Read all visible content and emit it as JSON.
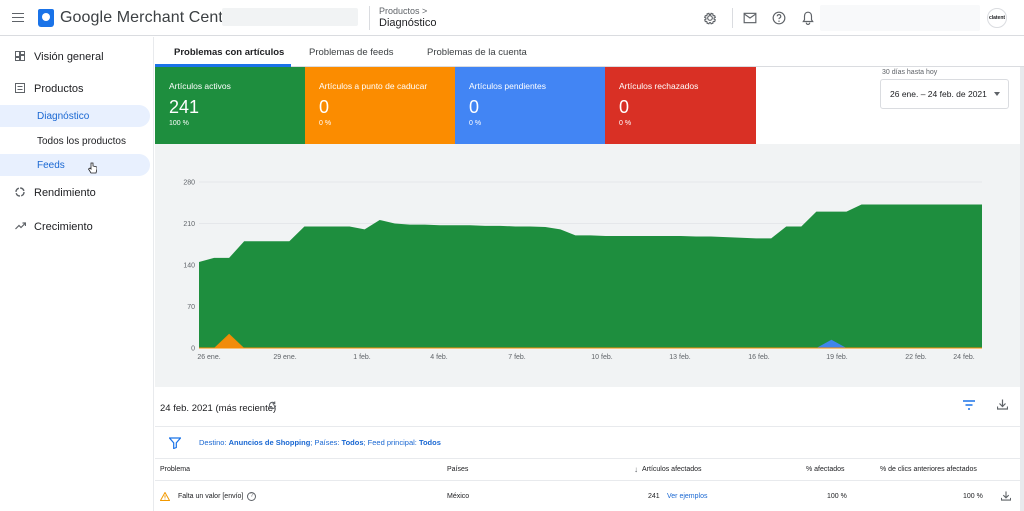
{
  "app": {
    "logo_text": "Google Merchant Center",
    "breadcrumb_parent": "Productos >",
    "breadcrumb_current": "Diagnóstico",
    "avatar_text": "clatent",
    "icons": [
      "menu-icon",
      "settings-icon",
      "mail-icon",
      "help-icon",
      "notifications-icon"
    ]
  },
  "sidebar": {
    "items": [
      {
        "label": "Visión general",
        "icon": "dashboard-icon"
      },
      {
        "label": "Productos",
        "icon": "list-icon"
      },
      {
        "label": "Diagnóstico"
      },
      {
        "label": "Todos los productos"
      },
      {
        "label": "Feeds"
      },
      {
        "label": "Rendimiento",
        "icon": "performance-icon"
      },
      {
        "label": "Crecimiento",
        "icon": "growth-icon"
      }
    ]
  },
  "tabs": [
    {
      "label": "Problemas con artículos",
      "active": true
    },
    {
      "label": "Problemas de feeds",
      "active": false
    },
    {
      "label": "Problemas de la cuenta",
      "active": false
    }
  ],
  "cards": [
    {
      "label": "Artículos activos",
      "value": "241",
      "pct": "100 %",
      "color": "#1e8e3e"
    },
    {
      "label": "Artículos a punto de caducar",
      "value": "0",
      "pct": "0 %",
      "color": "#fb8c00"
    },
    {
      "label": "Artículos pendientes",
      "value": "0",
      "pct": "0 %",
      "color": "#4285f4"
    },
    {
      "label": "Artículos rechazados",
      "value": "0",
      "pct": "0 %",
      "color": "#d93025"
    }
  ],
  "date_range": {
    "label": "30 días hasta hoy",
    "value": "26 ene. – 24 feb. de 2021"
  },
  "chart_data": {
    "type": "area",
    "x": [
      "26 ene.",
      "27 ene.",
      "28 ene.",
      "29 ene.",
      "30 ene.",
      "31 ene.",
      "1 feb.",
      "2 feb.",
      "3 feb.",
      "4 feb.",
      "5 feb.",
      "6 feb.",
      "7 feb.",
      "8 feb.",
      "9 feb.",
      "10 feb.",
      "11 feb.",
      "12 feb.",
      "13 feb.",
      "14 feb.",
      "15 feb.",
      "16 feb.",
      "17 feb.",
      "18 feb.",
      "19 feb.",
      "20 feb.",
      "21 feb.",
      "22 feb.",
      "23 feb.",
      "24 feb."
    ],
    "x_ticks": [
      "26 ene.",
      "29 ene.",
      "1 feb.",
      "4 feb.",
      "7 feb.",
      "10 feb.",
      "13 feb.",
      "16 feb.",
      "19 feb.",
      "22 feb.",
      "24 feb."
    ],
    "ylim": [
      0,
      280
    ],
    "y_ticks": [
      0,
      70,
      140,
      210,
      280
    ],
    "series": [
      {
        "values": [
          145,
          152,
          152,
          180,
          180,
          180,
          180,
          205,
          205,
          205,
          205,
          200,
          216,
          210,
          208,
          208,
          207,
          207,
          207,
          206,
          206,
          205,
          205,
          204,
          200,
          190,
          190,
          189,
          189,
          189,
          189,
          189,
          189,
          188,
          188,
          187,
          186,
          185,
          185,
          205,
          205,
          230,
          230,
          230,
          242,
          242,
          242,
          242,
          242,
          242,
          242,
          242,
          242
        ],
        "color": "#1e8e3e"
      },
      {
        "values": [
          0,
          0,
          20,
          0,
          0,
          0,
          0,
          0,
          0,
          0,
          0,
          0,
          0,
          0,
          0,
          0,
          0,
          0,
          0,
          0,
          0,
          0,
          0,
          0,
          0,
          0,
          0,
          0,
          0,
          0,
          0,
          0,
          0,
          0,
          0,
          0,
          0,
          0,
          0,
          0,
          0,
          0,
          14,
          0,
          0,
          0,
          0,
          0,
          0,
          0,
          0,
          0,
          0
        ],
        "color": "#4285f4"
      },
      {
        "values": [
          0,
          0,
          24,
          0,
          0,
          0,
          0,
          0,
          0,
          0,
          0,
          0,
          0,
          0,
          0,
          0,
          0,
          0,
          0,
          0,
          0,
          0,
          0,
          0,
          0,
          0,
          0,
          0,
          0,
          0,
          0,
          0,
          0,
          0,
          0,
          0,
          0,
          0,
          0,
          0,
          0,
          0,
          0,
          0,
          0,
          0,
          0,
          0,
          0,
          0,
          0,
          0,
          0
        ],
        "color": "#fb8c00"
      }
    ],
    "grid": true
  },
  "issues": {
    "date_title": "24 feb. 2021 (más reciente)",
    "filter_prefix": "Destino: ",
    "filter_dest": "Anuncios de Shopping",
    "filter_sep1": "; Países: ",
    "filter_countries": "Todos",
    "filter_sep2": "; Feed principal: ",
    "filter_feed": "Todos",
    "columns": [
      "Problema",
      "Países",
      "Artículos afectados",
      "% afectados",
      "% de clics anteriores afectados"
    ],
    "rows": [
      {
        "problem": "Falta un valor [envío]",
        "country": "México",
        "affected": "241",
        "examples": "Ver ejemplos",
        "pct": "100 %",
        "clicks_pct": "100 %"
      }
    ]
  }
}
